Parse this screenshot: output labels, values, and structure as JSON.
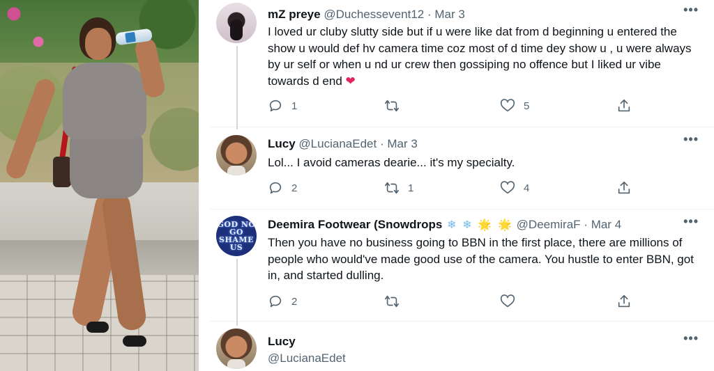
{
  "photo": {
    "icon": "photo-of-woman-drinking-water"
  },
  "tweets": [
    {
      "name": "mZ preye",
      "handle": "@Duchessevent12",
      "date": "Mar 3",
      "text": "I loved ur cluby slutty side but if u were like dat from d beginning u entered the show u would def hv camera time coz most of d time dey show u , u were always by ur self or when u nd ur crew then  gossiping no offence but I liked ur vibe towards  d end",
      "emoji": "❤",
      "replies": "1",
      "retweets": "",
      "likes": "5"
    },
    {
      "name": "Lucy",
      "handle": "@LucianaEdet",
      "date": "Mar 3",
      "text": "Lol... I avoid cameras dearie... it's my specialty.",
      "replies": "2",
      "retweets": "1",
      "likes": "4"
    },
    {
      "name": "Deemira Footwear (Snowdrops",
      "name_emojis": [
        "❄",
        "❄",
        "🌟",
        "🌟"
      ],
      "handle": "@DeemiraF",
      "date": "Mar 4",
      "avatar_text": "GOD NO GO SHAME US",
      "text": "Then you have no business going to BBN in the first place, there are millions of people who would've made good use of the camera. You hustle to enter BBN, got in, and started dulling.",
      "replies": "2",
      "retweets": "",
      "likes": ""
    },
    {
      "name": "Lucy",
      "handle": "@LucianaEdet"
    }
  ],
  "separator": "·",
  "more_glyph": "•••",
  "colors": {
    "muted": "#536471",
    "thread": "#cfd9de",
    "heart": "#e0245e"
  }
}
